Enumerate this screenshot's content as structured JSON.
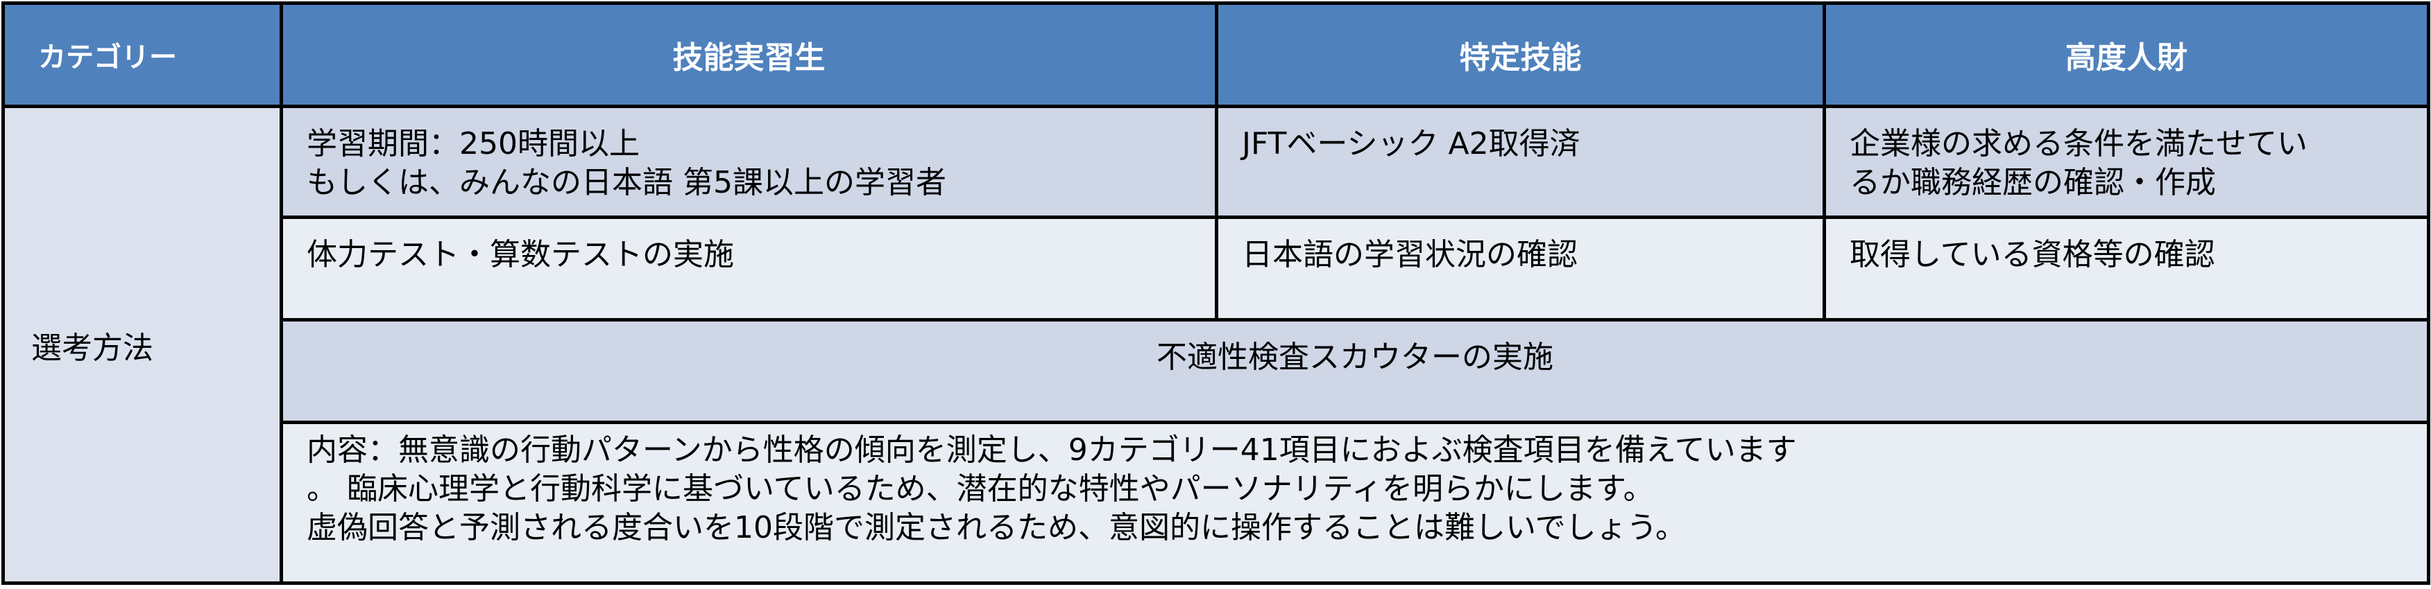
{
  "headers": {
    "category": "カテゴリー",
    "technical_intern": "技能実習生",
    "specified_skill": "特定技能",
    "highly_skilled": "高度人財"
  },
  "row_label": "選考方法",
  "rows": [
    {
      "technical_intern": [
        "学習期間：250時間以上",
        "もしくは、みんなの日本語 第5課以上の学習者"
      ],
      "specified_skill": [
        "JFTベーシック A2取得済"
      ],
      "highly_skilled": [
        "企業様の求める条件を満たせてい",
        "るか職務経歴の確認・作成"
      ]
    },
    {
      "technical_intern": [
        "体力テスト・算数テストの実施"
      ],
      "specified_skill": [
        "日本語の学習状況の確認"
      ],
      "highly_skilled": [
        "取得している資格等の確認"
      ]
    }
  ],
  "merged_title": "不適性検査スカウターの実施",
  "merged_content": [
    "内容：無意識の行動パターンから性格の傾向を測定し、9カテゴリー41項目におよぶ検査項目を備えています",
    "。 臨床心理学と行動科学に基づいているため、潜在的な特性やパーソナリティを明らかにします。",
    "虚偽回答と予測される度合いを10段階で測定されるため、意図的に操作することは難しいでしょう。"
  ],
  "colors": {
    "header_bg": "#4f81bd",
    "header_text": "#ffffff",
    "cell_dark": "#cfd6e6",
    "cell_light": "#e9edf4",
    "border": "#000000"
  }
}
